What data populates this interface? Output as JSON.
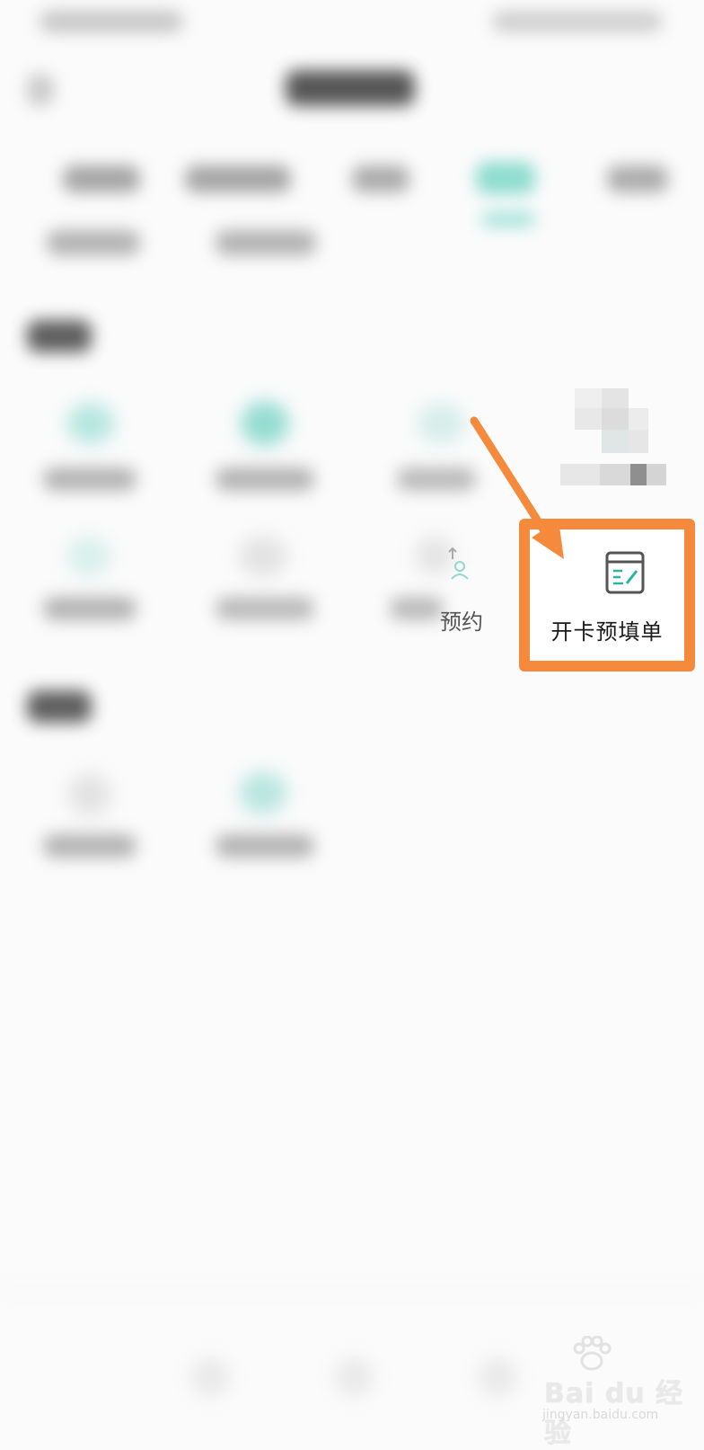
{
  "highlighted_item": {
    "label": "开卡预填单",
    "icon": "form-edit-icon",
    "icon_color": "#555555",
    "icon_accent": "#2bb5a0"
  },
  "partial_item": {
    "label": "预约",
    "icon": "person-icon"
  },
  "annotation": {
    "arrow_color": "#f58a3c",
    "box_color": "#f58a3c"
  },
  "watermark": {
    "brand": "Bai du 经验",
    "url": "jingyan.baidu.com"
  }
}
